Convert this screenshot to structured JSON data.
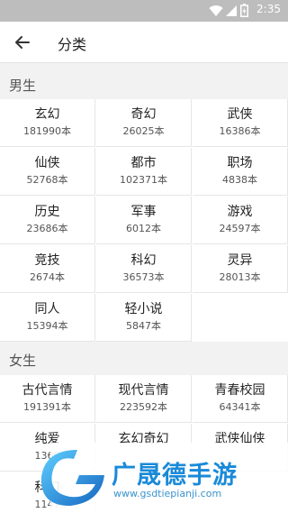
{
  "status_bar": {
    "time": "2:35"
  },
  "app_bar": {
    "title": "分类",
    "back_icon": "arrow-left-icon"
  },
  "sections": [
    {
      "title": "男生",
      "items": [
        {
          "name": "玄幻",
          "count": "181990本"
        },
        {
          "name": "奇幻",
          "count": "26025本"
        },
        {
          "name": "武侠",
          "count": "16386本"
        },
        {
          "name": "仙侠",
          "count": "52768本"
        },
        {
          "name": "都市",
          "count": "102371本"
        },
        {
          "name": "职场",
          "count": "4838本"
        },
        {
          "name": "历史",
          "count": "23686本"
        },
        {
          "name": "军事",
          "count": "6012本"
        },
        {
          "name": "游戏",
          "count": "24597本"
        },
        {
          "name": "竞技",
          "count": "2674本"
        },
        {
          "name": "科幻",
          "count": "36573本"
        },
        {
          "name": "灵异",
          "count": "28013本"
        },
        {
          "name": "同人",
          "count": "15394本"
        },
        {
          "name": "轻小说",
          "count": "5847本"
        }
      ]
    },
    {
      "title": "女生",
      "items": [
        {
          "name": "古代言情",
          "count": "191391本"
        },
        {
          "name": "现代言情",
          "count": "223592本"
        },
        {
          "name": "青春校园",
          "count": "64341本"
        },
        {
          "name": "纯爱",
          "count": "1369"
        },
        {
          "name": "玄幻奇幻",
          "count": ""
        },
        {
          "name": "武侠仙侠",
          "count": ""
        },
        {
          "name": "科幻",
          "count": "1147"
        }
      ]
    }
  ],
  "watermark": {
    "brand": "广晟德手游",
    "url": "www.gsdtiepianji.com",
    "logo_icon": "gsd-logo-icon"
  },
  "colors": {
    "accent": "#1a8ad8",
    "status_bar": "#bdbdbd"
  }
}
